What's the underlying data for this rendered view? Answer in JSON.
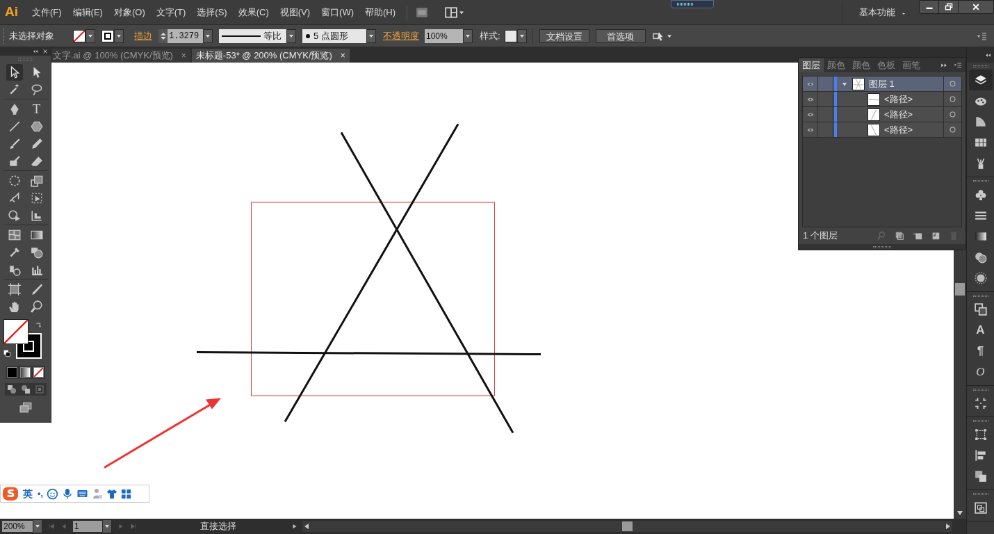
{
  "app": {
    "logo": "Ai",
    "menus": [
      "文件(F)",
      "编辑(E)",
      "对象(O)",
      "文字(T)",
      "选择(S)",
      "效果(C)",
      "视图(V)",
      "窗口(W)",
      "帮助(H)"
    ],
    "workspace": "基本功能"
  },
  "control_bar": {
    "selection": "未选择对象",
    "stroke_label": "描边",
    "stroke_weight": "1.3279",
    "stroke_profile": "等比",
    "brush": "5 点圆形",
    "opacity_label": "不透明度",
    "opacity": "100%",
    "style_label": "样式:",
    "buttons": [
      "文档设置",
      "首选项"
    ]
  },
  "tabs": [
    {
      "label": "文字.ai @ 100% (CMYK/预览)",
      "selected": false,
      "close": "×"
    },
    {
      "label": "未标题-53* @ 200% (CMYK/预览)",
      "selected": true,
      "close": "×"
    }
  ],
  "toolbar": {
    "type_tool_glyph": "T"
  },
  "layers_panel": {
    "tabs": [
      {
        "label": "图层",
        "selected": true
      },
      {
        "label": "颜色",
        "selected": false
      },
      {
        "label": "颜色",
        "selected": false
      },
      {
        "label": "色板",
        "selected": false
      },
      {
        "label": "画笔",
        "selected": false
      }
    ],
    "layers": [
      {
        "name": "图层 1",
        "visible": true,
        "expanded": true,
        "selected": true,
        "children": [
          {
            "name": "<路径>",
            "visible": true,
            "selected": false
          },
          {
            "name": "<路径>",
            "visible": true,
            "selected": false
          },
          {
            "name": "<路径>",
            "visible": true,
            "selected": false
          }
        ]
      }
    ],
    "count": "1 个图层"
  },
  "dock": {
    "character_glyph": "A",
    "paragraph_glyph": "¶",
    "opentype_glyph": "O"
  },
  "ime_bar": {
    "mode": "英",
    "punctuation": "•,"
  },
  "status_bar": {
    "zoom": "200%",
    "artboard": "1",
    "tool": "直接选择"
  }
}
